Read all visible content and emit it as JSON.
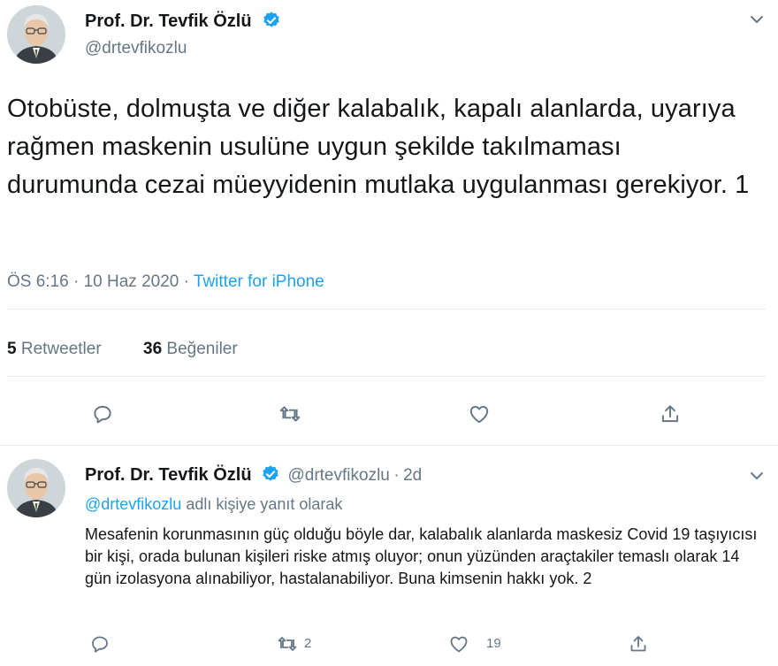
{
  "main_tweet": {
    "author_name": "Prof. Dr. Tevfik Özlü",
    "author_handle": "@drtevfikozlu",
    "text": "Otobüste, dolmuşta ve diğer kalabalık, kapalı alanlarda, uyarıya rağmen maskenin usulüne uygun şekilde takılmaması durumunda cezai müeyyidenin mutlaka uygulanması gerekiyor. 1",
    "time": "ÖS 6:16",
    "date": "10 Haz 2020",
    "source": "Twitter for iPhone",
    "separator": "·",
    "retweets_count": "5",
    "retweets_label": "Retweetler",
    "likes_count": "36",
    "likes_label": "Beğeniler"
  },
  "reply_tweet": {
    "author_name": "Prof. Dr. Tevfik Özlü",
    "author_handle": "@drtevfikozlu",
    "separator": "·",
    "age": "2d",
    "reply_to_handle": "@drtevfikozlu",
    "reply_to_suffix": "adlı kişiye yanıt olarak",
    "text": "Mesafenin korunmasının güç olduğu böyle dar, kalabalık alanlarda maskesiz Covid 19 taşıyıcısı bir kişi, orada bulunan kişileri riske atmış oluyor; onun yüzünden araçtakiler temaslı olarak 14 gün izolasyona alınabiliyor, hastalanabiliyor. Buna kimsenin hakkı yok. 2",
    "retweet_count": "2",
    "like_count": "19"
  },
  "colors": {
    "accent": "#1da1f2",
    "secondary_text": "#657786",
    "divider": "#e6ecf0"
  }
}
